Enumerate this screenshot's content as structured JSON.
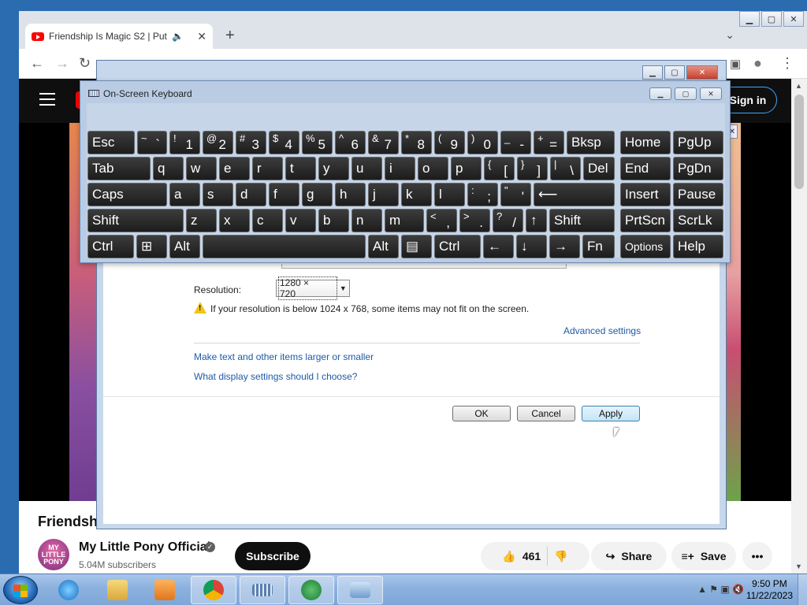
{
  "browser": {
    "tab_title": "Friendship Is Magic S2 | Putt",
    "audio_icon": "🔈",
    "close_icon": "✕",
    "new_tab_icon": "+",
    "tab_menu_icon": "⌄",
    "back_icon": "←",
    "forward_icon": "→",
    "reload_icon": "↻",
    "sidepanel_icon": "▣",
    "profile_icon": "●",
    "menu_icon": "⋮"
  },
  "youtube": {
    "signin_label": "Sign in",
    "video_title": "Friendsh",
    "channel_name": "My Little Pony Official",
    "channel_avatar_text": "MY LITTLE PONY",
    "verified_icon": "✓",
    "subscriber_count": "5.04M subscribers",
    "subscribe_label": "Subscribe",
    "like_icon": "👍",
    "like_count": "461",
    "dislike_icon": "👎",
    "share_icon": "↪",
    "share_label": "Share",
    "save_icon": "≡+",
    "save_label": "Save",
    "more_icon": "•••",
    "scroll_up": "▲",
    "scroll_down": "▼"
  },
  "display_dialog": {
    "minimize": "▁",
    "maximize": "▢",
    "close": "✕",
    "partial_close": "✕",
    "resolution_label": "Resolution:",
    "resolution_value": "1280 × 720",
    "resolution_arrow": "▼",
    "warning_mark": "!",
    "warning_text": "If your resolution is below 1024 x 768, some items may not fit on the screen.",
    "advanced_link": "Advanced settings",
    "textsize_link": "Make text and other items larger or smaller",
    "help_link": "What display settings should I choose?",
    "ok_label": "OK",
    "cancel_label": "Cancel",
    "apply_label": "Apply"
  },
  "osk": {
    "title": "On-Screen Keyboard",
    "minimize": "▁",
    "maximize": "▢",
    "close": "✕",
    "keys": {
      "esc": "Esc",
      "tilde_shift": "~",
      "tilde_base": "`",
      "k1_shift": "!",
      "k1": "1",
      "k2_shift": "@",
      "k2": "2",
      "k3_shift": "#",
      "k3": "3",
      "k4_shift": "$",
      "k4": "4",
      "k5_shift": "%",
      "k5": "5",
      "k6_shift": "^",
      "k6": "6",
      "k7_shift": "&",
      "k7": "7",
      "k8_shift": "*",
      "k8": "8",
      "k9_shift": "(",
      "k9": "9",
      "k0_shift": ")",
      "k0": "0",
      "minus_shift": "_",
      "minus": "-",
      "plus_shift": "+",
      "plus": "=",
      "bksp": "Bksp",
      "home": "Home",
      "pgup": "PgUp",
      "tab": "Tab",
      "q": "q",
      "w": "w",
      "e": "e",
      "r": "r",
      "t": "t",
      "y": "y",
      "u": "u",
      "i": "i",
      "o": "o",
      "p": "p",
      "lbr_shift": "{",
      "lbr": "[",
      "rbr_shift": "}",
      "rbr": "]",
      "bs_shift": "|",
      "bs": "\\",
      "del": "Del",
      "end": "End",
      "pgdn": "PgDn",
      "caps": "Caps",
      "a": "a",
      "s": "s",
      "d": "d",
      "f": "f",
      "g": "g",
      "h": "h",
      "j": "j",
      "k": "k",
      "l": "l",
      "semi_shift": ":",
      "semi": ";",
      "quote_shift": "\"",
      "quote": "'",
      "enter": "⟵",
      "insert": "Insert",
      "pause": "Pause",
      "shift": "Shift",
      "z": "z",
      "x": "x",
      "c": "c",
      "v": "v",
      "b": "b",
      "n": "n",
      "m": "m",
      "comma_shift": "<",
      "comma": ",",
      "period_shift": ">",
      "period": ".",
      "slash_shift": "?",
      "slash": "/",
      "up": "↑",
      "rshift": "Shift",
      "prtscn": "PrtScn",
      "scrlk": "ScrLk",
      "ctrl": "Ctrl",
      "win": "⊞",
      "alt": "Alt",
      "space": "",
      "ralt": "Alt",
      "menu": "▤",
      "rctrl": "Ctrl",
      "left": "←",
      "down": "↓",
      "right": "→",
      "fn": "Fn",
      "options": "Options",
      "help": "Help"
    }
  },
  "taskbar": {
    "tray_icons": "▲  ⚑  ▣  🔇",
    "time": "9:50 PM",
    "date": "11/22/2023"
  },
  "outer": {
    "minimize": "▁",
    "maximize": "▢",
    "close": "✕"
  }
}
